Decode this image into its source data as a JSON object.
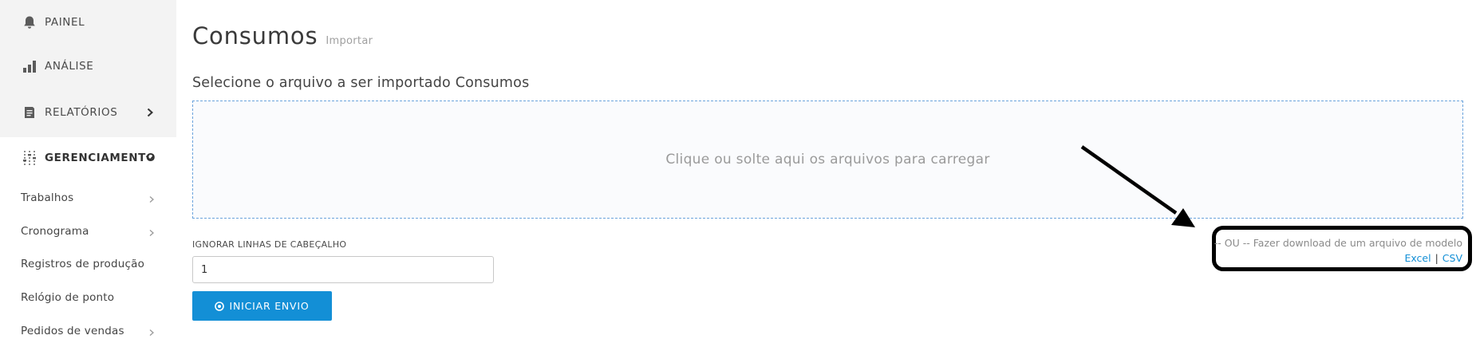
{
  "sidebar": {
    "items": [
      {
        "label": "PAINEL",
        "icon": "bell-icon"
      },
      {
        "label": "ANÁLISE",
        "icon": "bar-chart-icon"
      },
      {
        "label": "RELATÓRIOS",
        "icon": "document-icon"
      },
      {
        "label": "GERENCIAMENTO",
        "icon": "sliders-icon",
        "expanded": true
      }
    ],
    "subitems": [
      {
        "label": "Trabalhos",
        "has_children": true
      },
      {
        "label": "Cronograma",
        "has_children": true
      },
      {
        "label": "Registros de produção",
        "has_children": false
      },
      {
        "label": "Relógio de ponto",
        "has_children": false
      },
      {
        "label": "Pedidos de vendas",
        "has_children": true
      }
    ]
  },
  "page": {
    "title": "Consumos",
    "subtitle": "Importar",
    "section_heading": "Selecione o arquivo a ser importado Consumos",
    "dropzone_text": "Clique ou solte aqui os arquivos para carregar",
    "header_lines_label": "IGNORAR LINHAS DE CABEÇALHO",
    "header_lines_value": "1",
    "submit_label": "INICIAR ENVIO",
    "template_text": "-- OU -- Fazer download de um arquivo de modelo",
    "template_excel": "Excel",
    "template_separator": "|",
    "template_csv": "CSV"
  },
  "colors": {
    "primary": "#138fd6",
    "sidebar_bg": "#f3f3f3",
    "annotation": "#000000"
  }
}
